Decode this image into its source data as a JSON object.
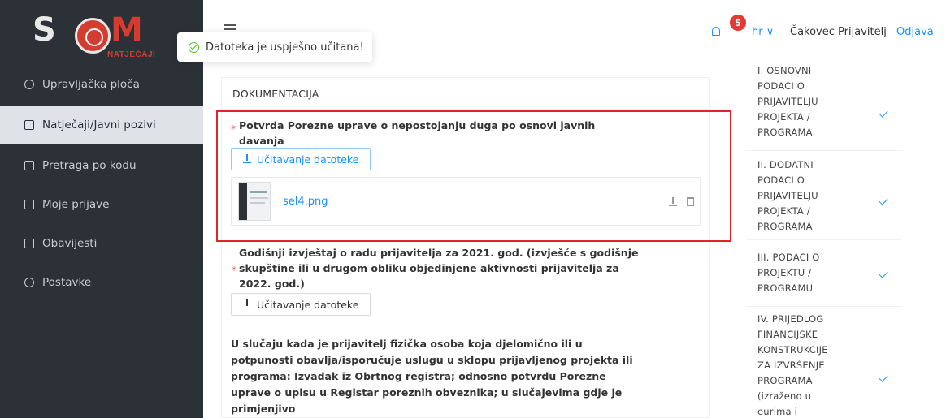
{
  "brand": {
    "logo_main": "S",
    "logo_m": "M",
    "logo_sub": "NATJEČAJI",
    "accent": "#d33c2f"
  },
  "sidebar": {
    "items": [
      {
        "label": "Upravljačka ploča",
        "icon": "dashboard-icon"
      },
      {
        "label": "Natječaji/Javni pozivi",
        "icon": "folder-icon",
        "active": true
      },
      {
        "label": "Pretraga po kodu",
        "icon": "code-search-icon"
      },
      {
        "label": "Moje prijave",
        "icon": "document-icon"
      },
      {
        "label": "Obavijesti",
        "icon": "bell-icon"
      },
      {
        "label": "Postavke",
        "icon": "settings-icon"
      }
    ]
  },
  "header": {
    "notification_count": "5",
    "language": "hr ∨",
    "user": "Čakovec Prijavitelj",
    "logout": "Odjava"
  },
  "toast": {
    "message": "Datoteka je uspješno učitana!"
  },
  "main": {
    "section_title": "DOKUMENTACIJA",
    "q1_label_line1": "Potvrda Porezne uprave o nepostojanju duga po osnovi javnih",
    "q1_label_line2": "davanja",
    "upload_label": "Učitavanje datoteke",
    "file_name": "sel4.png",
    "q2_line1": "Godišnji izvještaj o radu prijavitelja za 2021. god. (izvješće s godišnje",
    "q2_line2": "skupštine ili u drugom obliku objedinjene aktivnosti prijavitelja za",
    "q2_line3": "2022. god.)",
    "q3_line1": "U slučaju kada je prijavitelj fizička osoba koja djelomično ili u",
    "q3_line2": "potpunosti obavlja/isporučuje uslugu u sklopu prijavljenog projekta ili",
    "q3_line3": "programa: Izvadak iz Obrtnog registra; odnosno potvrdu Porezne",
    "q3_line4": "uprave o upisu u Registar poreznih obveznika; u slučajevima gdje je",
    "q3_line5": "primjenjivo"
  },
  "steps": [
    {
      "lines": [
        "I. OSNOVNI",
        "PODACI O",
        "PRIJAVITELJU",
        "PROJEKTA /",
        "PROGRAMA"
      ]
    },
    {
      "lines": [
        "II. DODATNI",
        "PODACI O",
        "PRIJAVITELJU",
        "PROJEKTA /",
        "PROGRAMA"
      ]
    },
    {
      "lines": [
        "III. PODACI O",
        "PROJEKTU /",
        "PROGRAMU"
      ]
    },
    {
      "lines": [
        "IV. PRIJEDLOG",
        "FINANCIJSKE",
        "KONSTRUKCIJE",
        "ZA IZVRŠENJE",
        "PROGRAMA",
        "(izraženo u",
        "eurima i"
      ]
    }
  ]
}
